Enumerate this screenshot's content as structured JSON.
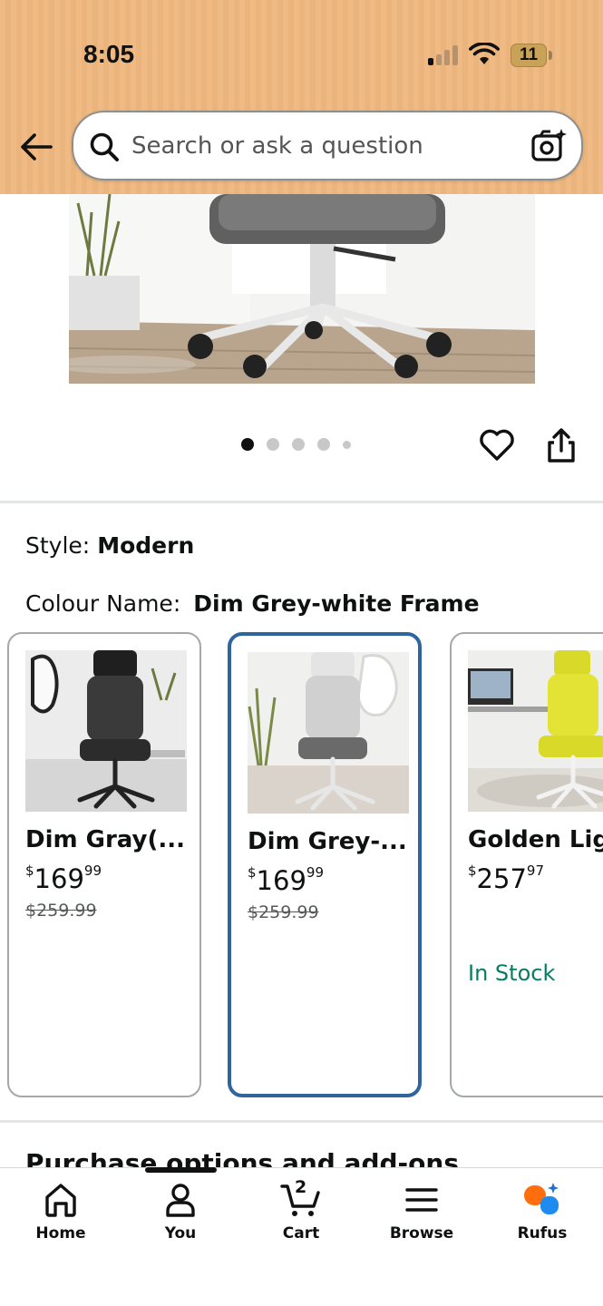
{
  "status_bar": {
    "time": "8:05",
    "battery": "11"
  },
  "search": {
    "placeholder": "Search or ask a question"
  },
  "carousel": {
    "total": 5,
    "active": 1
  },
  "variation": {
    "style_label": "Style:",
    "style_value": "Modern",
    "colour_label": "Colour Name:",
    "colour_value": "Dim Grey-white Frame"
  },
  "swatches": [
    {
      "title": "Dim Gray(...",
      "currency": "$",
      "price_whole": "169",
      "price_fraction": "99",
      "was_price": "$259.99",
      "stock": "",
      "selected": false
    },
    {
      "title": "Dim Grey-...",
      "currency": "$",
      "price_whole": "169",
      "price_fraction": "99",
      "was_price": "$259.99",
      "stock": "",
      "selected": true
    },
    {
      "title": "Golden Ligh",
      "currency": "$",
      "price_whole": "257",
      "price_fraction": "97",
      "was_price": "",
      "stock": "In Stock",
      "selected": false
    }
  ],
  "section_heading": "Purchase options and add-ons",
  "bottom_nav": {
    "items": [
      {
        "label": "Home",
        "icon": "home-icon"
      },
      {
        "label": "You",
        "icon": "person-icon"
      },
      {
        "label": "Cart",
        "icon": "cart-icon"
      },
      {
        "label": "Browse",
        "icon": "menu-icon"
      },
      {
        "label": "Rufus",
        "icon": "rufus-icon"
      }
    ],
    "cart_count": "2"
  },
  "colors": {
    "header_bg": "#efba84",
    "selected_border": "#2f659f",
    "in_stock": "#067d62",
    "rufus_orange": "#ff6d0d",
    "rufus_blue": "#1e8bf0"
  }
}
